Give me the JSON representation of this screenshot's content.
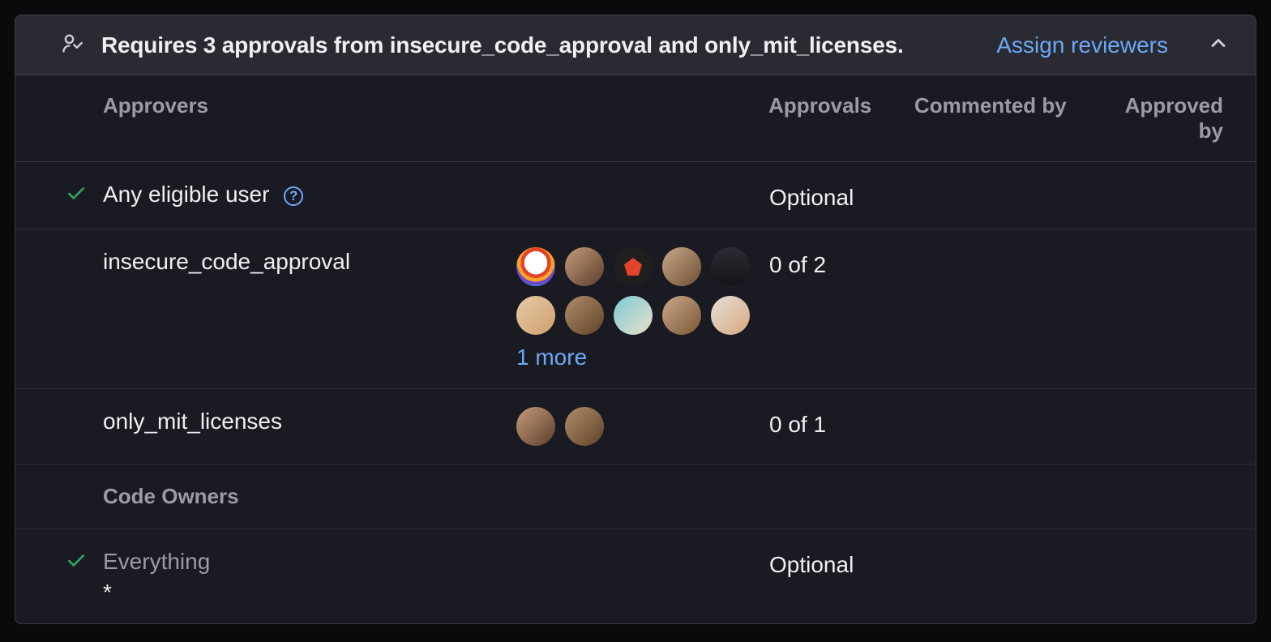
{
  "header": {
    "title": "Requires 3 approvals from insecure_code_approval and only_mit_licenses.",
    "assign_reviewers": "Assign reviewers"
  },
  "columns": {
    "approvers": "Approvers",
    "approvals": "Approvals",
    "commented_by": "Commented by",
    "approved_by": "Approved by"
  },
  "rows": {
    "any_eligible": {
      "label": "Any eligible user",
      "approvals": "Optional",
      "help": "?"
    },
    "insecure": {
      "label": "insecure_code_approval",
      "approvals": "0 of 2",
      "more": "1 more"
    },
    "only_mit": {
      "label": "only_mit_licenses",
      "approvals": "0 of 1"
    },
    "everything": {
      "label": "Everything",
      "pattern": "*",
      "approvals": "Optional"
    }
  },
  "sections": {
    "code_owners": "Code Owners"
  }
}
